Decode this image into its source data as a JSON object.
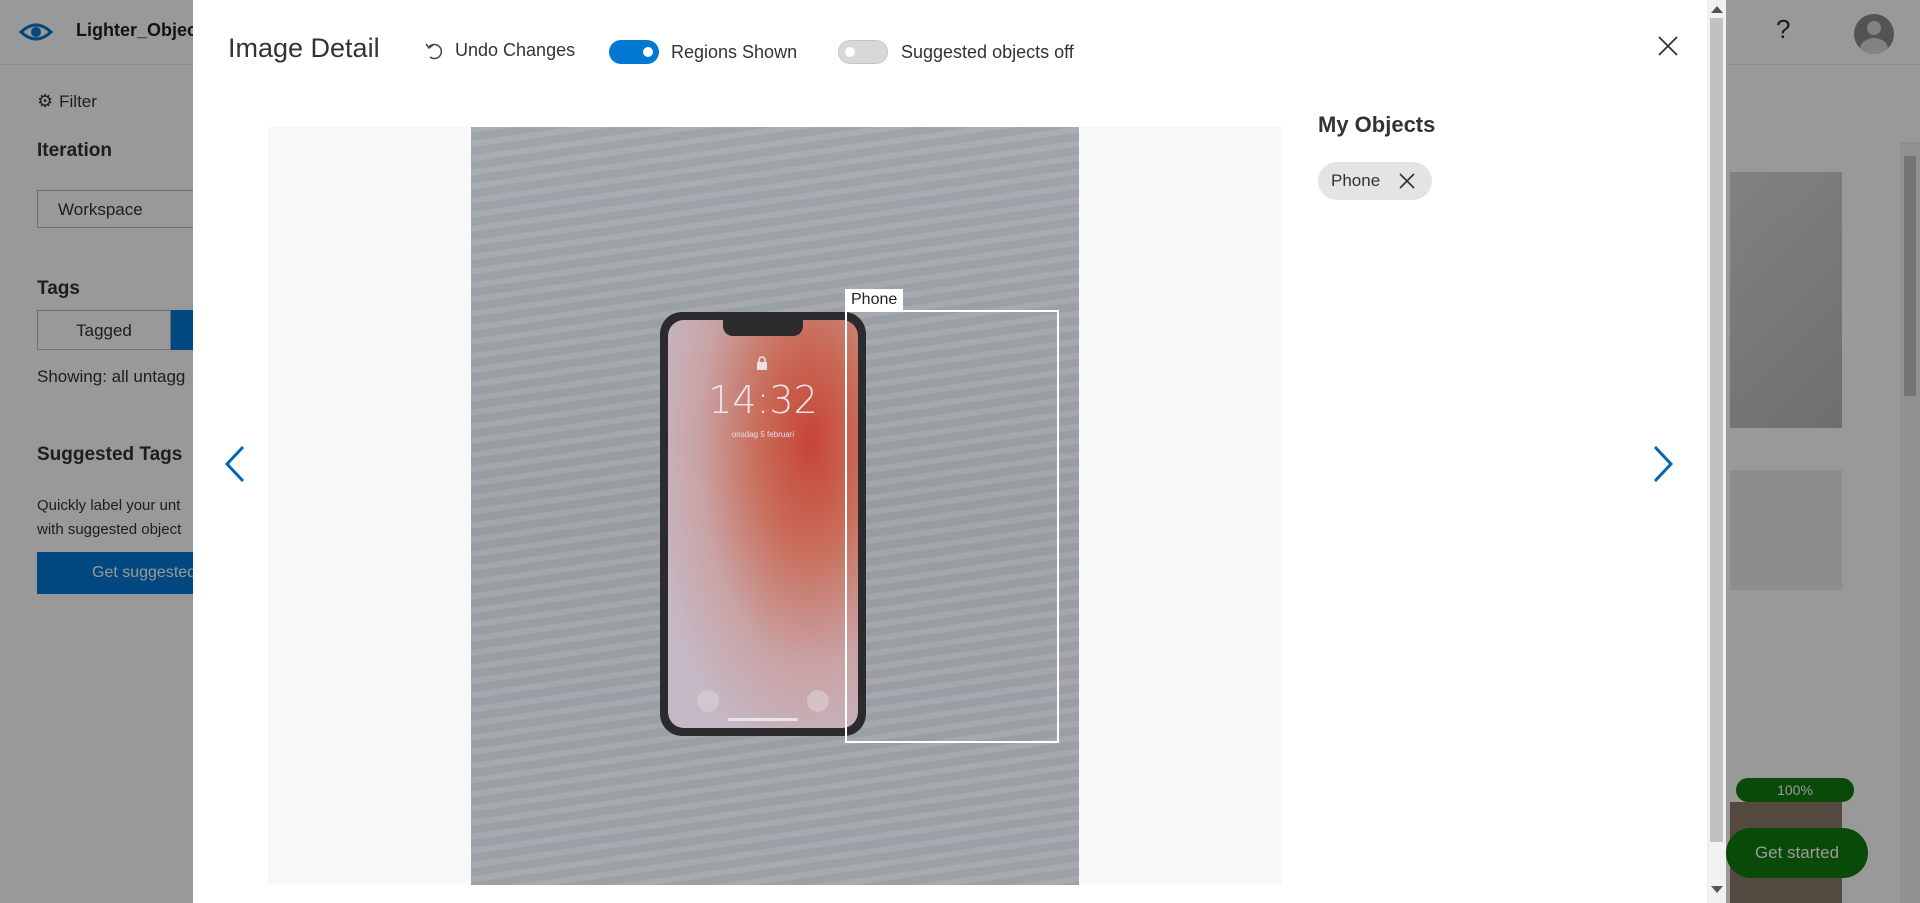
{
  "app": {
    "project_name": "Lighter_Object",
    "help_glyph": "?",
    "logo_icon": "eye-icon",
    "avatar_icon": "user-avatar-icon"
  },
  "left_panel": {
    "filter_label": "Filter",
    "iteration_label": "Iteration",
    "iteration_value": "Workspace",
    "tags_label": "Tags",
    "tag_tabs": [
      "Tagged",
      ""
    ],
    "showing_text": "Showing: all untagg",
    "suggested_tags_label": "Suggested Tags",
    "suggested_desc_line1": "Quickly label your unt",
    "suggested_desc_line2": "with suggested object",
    "suggested_button": "Get suggested"
  },
  "right_bg": {
    "progress_badge": "100%",
    "get_started_label": "Get started"
  },
  "modal": {
    "title": "Image Detail",
    "undo_label": "Undo Changes",
    "regions_toggle": {
      "label": "Regions Shown",
      "on": true
    },
    "suggested_toggle": {
      "label": "Suggested objects off",
      "on": false
    },
    "close_icon": "close-icon",
    "image": {
      "region_label": "Phone",
      "phone_time": "14:32",
      "phone_date": "onsdag 5 februari"
    },
    "my_objects_title": "My Objects",
    "objects": [
      "Phone"
    ],
    "prev_icon": "chevron-left-icon",
    "next_icon": "chevron-right-icon"
  },
  "colors": {
    "accent": "#0078d4",
    "success": "#107c10",
    "overlay": "rgba(0,0,0,0.4)"
  }
}
